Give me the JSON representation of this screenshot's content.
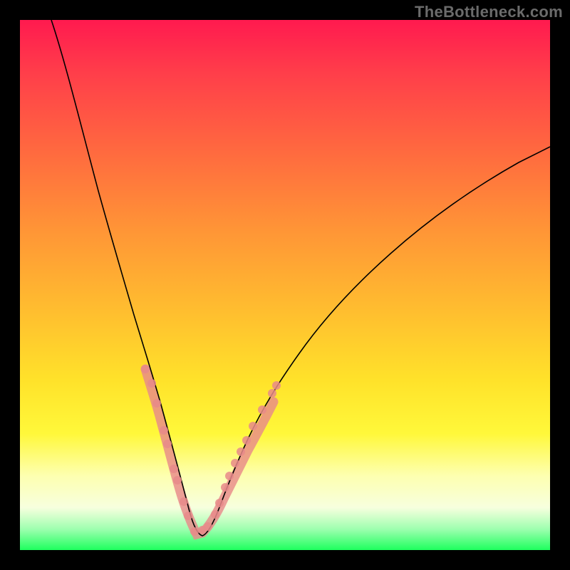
{
  "attribution": "TheBottleneck.com",
  "colors": {
    "gradient_top": "#ff1a4f",
    "gradient_mid": "#ffe22a",
    "gradient_bottom": "#1eff5e",
    "curve": "#000000",
    "band": "#e88a8a",
    "frame": "#000000"
  },
  "chart_data": {
    "type": "line",
    "title": "",
    "xlabel": "",
    "ylabel": "",
    "xlim": [
      0,
      100
    ],
    "ylim": [
      0,
      100
    ],
    "note": "No numeric axes are rendered; values below are read off the 744×744 plot in percent of plot width (x) and percent of plot height from top (y). The curve is an asymmetric V with its minimum near x≈33%.",
    "series": [
      {
        "name": "curve",
        "style": "smooth-black-line",
        "x": [
          5.9,
          10.8,
          14.8,
          18.8,
          21.5,
          23.7,
          25.8,
          27.7,
          29.6,
          31.5,
          33.3,
          35.2,
          37.1,
          39.0,
          41.4,
          43.8,
          47.0,
          51.1,
          56.5,
          62.2,
          70.3,
          80.4,
          89.8,
          97.2
        ],
        "y": [
          0.0,
          16.1,
          32.3,
          48.4,
          58.1,
          65.2,
          72.6,
          79.7,
          86.8,
          92.2,
          97.0,
          97.0,
          92.5,
          87.6,
          82.3,
          77.2,
          71.2,
          65.1,
          57.5,
          50.9,
          43.3,
          35.8,
          29.3,
          25.3
        ]
      },
      {
        "name": "highlight-band",
        "style": "thick-salmon-overlay",
        "description": "overlay along the curve between roughly 72%–98% depth (from top), marking the bottom region of the V",
        "x_range": [
          23.7,
          48.4
        ],
        "y_range": [
          70.0,
          98.0
        ]
      }
    ],
    "markers": {
      "name": "salmon-dots",
      "points": [
        {
          "x": 23.7,
          "y": 65.9
        },
        {
          "x": 24.9,
          "y": 68.5
        },
        {
          "x": 25.8,
          "y": 72.3
        },
        {
          "x": 27.2,
          "y": 77.4
        },
        {
          "x": 27.8,
          "y": 80.0
        },
        {
          "x": 29.0,
          "y": 84.7
        },
        {
          "x": 29.7,
          "y": 86.8
        },
        {
          "x": 30.9,
          "y": 90.9
        },
        {
          "x": 31.7,
          "y": 93.5
        },
        {
          "x": 32.9,
          "y": 96.5
        },
        {
          "x": 34.4,
          "y": 96.2
        },
        {
          "x": 35.5,
          "y": 95.6
        },
        {
          "x": 36.8,
          "y": 93.3
        },
        {
          "x": 37.6,
          "y": 91.1
        },
        {
          "x": 38.7,
          "y": 88.2
        },
        {
          "x": 39.5,
          "y": 86.0
        },
        {
          "x": 40.6,
          "y": 83.6
        },
        {
          "x": 41.7,
          "y": 81.5
        },
        {
          "x": 42.7,
          "y": 79.3
        },
        {
          "x": 44.0,
          "y": 76.6
        },
        {
          "x": 45.7,
          "y": 73.5
        },
        {
          "x": 47.6,
          "y": 70.4
        },
        {
          "x": 48.4,
          "y": 69.0
        }
      ]
    }
  }
}
